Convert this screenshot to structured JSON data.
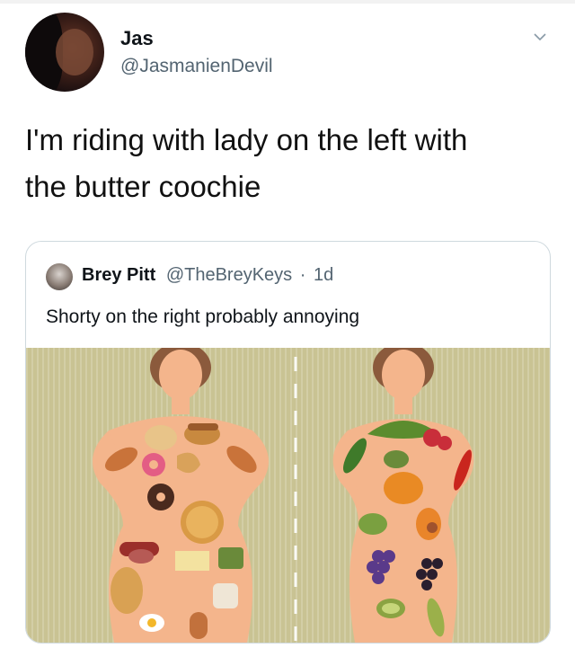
{
  "tweet": {
    "author_name": "Jas",
    "author_handle": "@JasmanienDevil",
    "text_line1": "I'm riding with lady on the left with",
    "text_line2": "the butter coochie"
  },
  "quoted_tweet": {
    "author_name": "Brey Pitt",
    "author_handle": "@TheBreyKeys",
    "separator": "·",
    "time": "1d",
    "text": "Shorty on the right probably annoying"
  },
  "icons": {
    "menu": "chevron-down-icon"
  },
  "colors": {
    "text_primary": "#0f1419",
    "text_secondary": "#536471",
    "border": "#cfd9de",
    "image_background": "#c9c393",
    "skin": "#f4b58c"
  }
}
